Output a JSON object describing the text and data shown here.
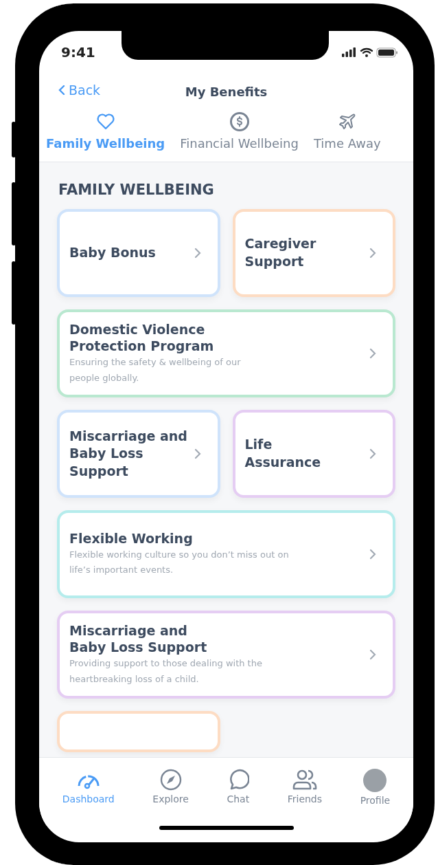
{
  "status_bar": {
    "time": "9:41"
  },
  "nav": {
    "back": "Back",
    "title": "My Benefits"
  },
  "tabs": [
    {
      "label": "Family Wellbeing",
      "kind": "heart",
      "selected": true
    },
    {
      "label": "Financial Wellbeing",
      "kind": "dollar",
      "selected": false
    },
    {
      "label": "Time Away",
      "kind": "plane",
      "selected": false
    }
  ],
  "section": {
    "heading": "FAMILY WELLBEING"
  },
  "cards": [
    {
      "kind": "half",
      "title": "Baby Bonus",
      "color": "#cfe3fb"
    },
    {
      "kind": "half",
      "title": "Caregiver\nSupport",
      "color": "#fddcc3"
    },
    {
      "kind": "full",
      "title": "Domestic Violence\nProtection Program",
      "description": "Ensuring the safety & wellbeing of our\npeople globally.",
      "color": "#b9e8d0"
    },
    {
      "kind": "half",
      "title": "Miscarriage and\nBaby Loss\nSupport",
      "color": "#cfe3fb"
    },
    {
      "kind": "half",
      "title": "Life\nAssurance",
      "color": "#e5cdf3"
    },
    {
      "kind": "full",
      "title": "Flexible Working",
      "description": "Flexible working culture so you don’t miss out on\nlife’s important events.",
      "color": "#b5ecec"
    },
    {
      "kind": "full",
      "title": "Miscarriage and\nBaby Loss Support",
      "description": "Providing support to those dealing with the\nheartbreaking loss of a child.",
      "color": "#e5cdf3"
    },
    {
      "kind": "peek",
      "color": "#fddcc3"
    }
  ],
  "bottom_nav": [
    {
      "label": "Dashboard",
      "kind": "gauge",
      "selected": true
    },
    {
      "label": "Explore",
      "kind": "compass",
      "selected": false
    },
    {
      "label": "Chat",
      "kind": "chat",
      "selected": false
    },
    {
      "label": "Friends",
      "kind": "people",
      "selected": false
    },
    {
      "label": "Profile",
      "kind": "avatar",
      "selected": false
    }
  ]
}
